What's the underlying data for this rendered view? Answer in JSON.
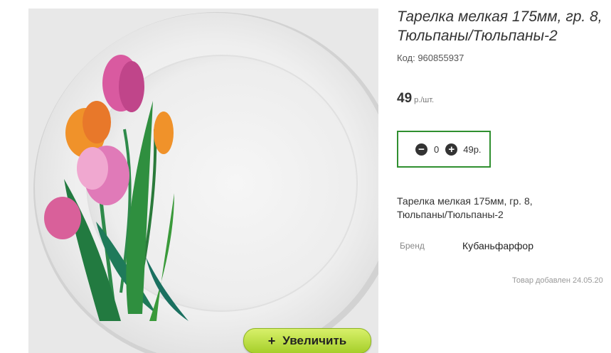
{
  "product": {
    "title": "Тарелка мелкая 175мм, гр. 8, Тюльпаны/Тюльпаны-2",
    "code": "Код: 960855937",
    "price_value": "49",
    "price_unit": "р./шт.",
    "description": "Тарелка мелкая 175мм, гр. 8, Тюльпаны/Тюльпаны-2",
    "brand_label": "Бренд",
    "brand_value": "Кубаньфарфор",
    "added_text": "Товар добавлен 24.05.20"
  },
  "quantity": {
    "minus_icon": "minus-circle-icon",
    "plus_icon": "plus-circle-icon",
    "value": "0",
    "sum": "49р."
  },
  "gallery": {
    "zoom_plus": "+",
    "zoom_label": "Увеличить"
  },
  "colors": {
    "qty_border": "#2f8f2f",
    "zoom_button": "#b6dc3a"
  }
}
